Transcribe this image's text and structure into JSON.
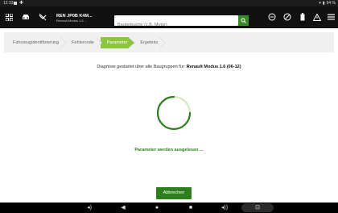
{
  "status_bar": {
    "time": "12:33",
    "battery": "94 %"
  },
  "toolbar": {
    "vehicle_line1": "REN JP0B K4M...",
    "vehicle_line2": "Renault Modus 1.6 ...",
    "search_placeholder": "Bauteilsuche (z.B. Motor)",
    "icons": [
      "grid-icon",
      "car-icon",
      "no-connection-icon",
      "minus-circle-icon",
      "gauge-icon",
      "battery-icon",
      "warning-icon",
      "menu-icon"
    ]
  },
  "steps": [
    {
      "label": "Fahrzeugidentifizierung",
      "active": false
    },
    {
      "label": "Fehlercode",
      "active": false
    },
    {
      "label": "Parameter",
      "active": true
    },
    {
      "label": "Ergebnis",
      "active": false
    }
  ],
  "main": {
    "diagnosis_prefix": "Diagnose gestartet über alle Baugruppen für:",
    "diagnosis_vehicle": "Renault Modus 1.6 (06-12)",
    "loading_text": "Parameter werden ausgelesen ...",
    "cancel_label": "Abbrechen"
  },
  "colors": {
    "accent": "#8cc63f",
    "primary": "#2e7d1e"
  }
}
